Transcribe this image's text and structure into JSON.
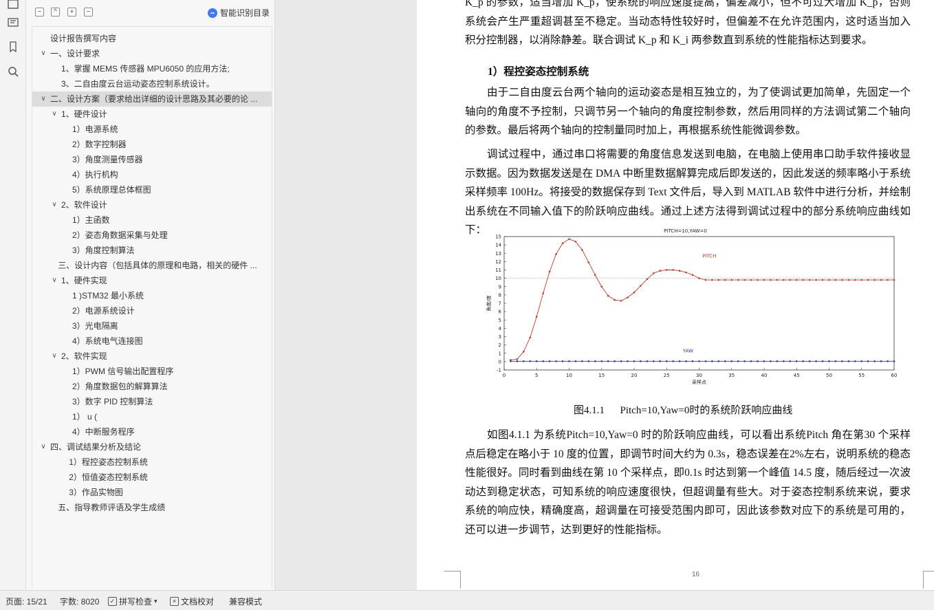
{
  "panel": {
    "toolbar": {
      "collapse_all": "−",
      "expand_all": "^",
      "add_heading": "+",
      "remove_heading": "−",
      "smart_toc": "智能识别目录"
    },
    "outline": [
      {
        "label": "设计报告撰写内容",
        "level": 0,
        "chevron": ""
      },
      {
        "label": "一、设计要求",
        "level": 0,
        "chevron": "v"
      },
      {
        "label": "1、掌握 MEMS 传感器 MPU6050 的应用方法;",
        "level": 1,
        "chevron": ""
      },
      {
        "label": "3、二自由度云台运动姿态控制系统设计。",
        "level": 1,
        "chevron": ""
      },
      {
        "label": "二、设计方案（要求给出详细的设计思路及其必要的论 ...",
        "level": 0,
        "chevron": "v",
        "selected": true
      },
      {
        "label": "1、硬件设计",
        "level": 1,
        "chevron": "v"
      },
      {
        "label": "1）电源系统",
        "level": 2,
        "chevron": ""
      },
      {
        "label": "2）数字控制器",
        "level": 2,
        "chevron": ""
      },
      {
        "label": "3）角度测量传感器",
        "level": 2,
        "chevron": ""
      },
      {
        "label": "4）执行机构",
        "level": 2,
        "chevron": ""
      },
      {
        "label": "5）系统原理总体框图",
        "level": 2,
        "chevron": ""
      },
      {
        "label": "2、软件设计",
        "level": 1,
        "chevron": "v"
      },
      {
        "label": "1）主函数",
        "level": 2,
        "chevron": ""
      },
      {
        "label": "2）姿态角数据采集与处理",
        "level": 2,
        "chevron": ""
      },
      {
        "label": "3）角度控制算法",
        "level": 2,
        "chevron": ""
      },
      {
        "label": "三、设计内容（包括具体的原理和电路，相关的硬件 ...",
        "level": 0.7,
        "chevron": ""
      },
      {
        "label": "1、硬件实现",
        "level": 1,
        "chevron": "v"
      },
      {
        "label": "1 )STM32 最小系统",
        "level": 2,
        "chevron": ""
      },
      {
        "label": "2）电源系统设计",
        "level": 2,
        "chevron": ""
      },
      {
        "label": "3）光电隔离",
        "level": 2,
        "chevron": ""
      },
      {
        "label": "4）系统电气连接图",
        "level": 2,
        "chevron": ""
      },
      {
        "label": "2、软件实现",
        "level": 1,
        "chevron": "v"
      },
      {
        "label": "1）PWM 信号输出配置程序",
        "level": 2,
        "chevron": ""
      },
      {
        "label": "2）角度数据包的解算算法",
        "level": 2,
        "chevron": ""
      },
      {
        "label": "3）数字 PID 控制算法",
        "level": 2,
        "chevron": ""
      },
      {
        "label": "1）        u (",
        "level": 2,
        "chevron": ""
      },
      {
        "label": "4）中断服务程序",
        "level": 2,
        "chevron": ""
      },
      {
        "label": "四、调试结果分析及结论",
        "level": 0,
        "chevron": "v"
      },
      {
        "label": "1）程控姿态控制系统",
        "level": 1.7,
        "chevron": ""
      },
      {
        "label": "2）恒值姿态控制系统",
        "level": 1.7,
        "chevron": ""
      },
      {
        "label": "3）作品实物图",
        "level": 1.7,
        "chevron": ""
      },
      {
        "label": "五、指导教师评语及学生成绩",
        "level": 0.7,
        "chevron": ""
      }
    ]
  },
  "document": {
    "p1": "K_p 的参数，适当增加 K_p，使系统的响应速度提高，偏差减小，但不可过大增加 K_p，否则系统会产生严重超调甚至不稳定。当动态特性较好时，但偏差不在允许范围内，这时适当加入积分控制器，以消除静差。联合调试 K_p 和 K_i 两参数直到系统的性能指标达到要求。",
    "heading1": "1）程控姿态控制系统",
    "p2": "由于二自由度云台两个轴向的运动姿态是相互独立的，为了使调试更加简单，先固定一个轴向的角度不予控制，只调节另一个轴向的角度控制参数，然后用同样的方法调试第二个轴向的参数。最后将两个轴向的控制量同时加上，再根据系统性能微调参数。",
    "p3": "调试过程中，通过串口将需要的角度信息发送到电脑，在电脑上使用串口助手软件接收显示数据。因为数据发送是在 DMA 中断里数据解算完成后即发送的，因此发送的频率略小于系统采样频率 100Hz。将接受的数据保存到 Text 文件后，导入到 MATLAB 软件中进行分析，并绘制出系统在不同输入值下的阶跃响应曲线。通过上述方法得到调试过程中的部分系统响应曲线如下：",
    "caption": "图4.1.1      Pitch=10,Yaw=0时的系统阶跃响应曲线",
    "p4": "如图4.1.1 为系统Pitch=10,Yaw=0 时的阶跃响应曲线，可以看出系统Pitch 角在第30 个采样点后稳定在略小于 10 度的位置，即调节时间大约为 0.3s，稳态误差在2%左右，说明系统的稳态性能很好。同时看到曲线在第 10 个采样点，即0.1s 时达到第一个峰值 14.5 度，随后经过一次波动达到稳定状态，可知系统的响应速度很快，但超调量有些大。对于姿态控制系统来说，要求系统的响应快，精确度高，超调量在可接受范围内即可，因此该参数对应下的系统是可用的，还可以进一步调节，达到更好的性能指标。",
    "page_number": "16"
  },
  "chart_data": {
    "type": "line",
    "title": "PITCH=10,YAW=0",
    "xlabel": "采样点",
    "ylabel": "角度/度",
    "xlim": [
      0,
      60
    ],
    "ylim": [
      -1,
      15
    ],
    "xticks": [
      0,
      5,
      10,
      15,
      20,
      25,
      30,
      35,
      40,
      45,
      50,
      55,
      60
    ],
    "yticks": [
      -1,
      0,
      1,
      2,
      3,
      4,
      5,
      6,
      7,
      8,
      9,
      10,
      11,
      12,
      13,
      14,
      15
    ],
    "reference_line": 10,
    "annotations": [
      "PITCH",
      "YAW"
    ],
    "series": [
      {
        "name": "PITCH",
        "color": "#c0392b",
        "x": [
          1,
          2,
          3,
          4,
          5,
          6,
          7,
          8,
          9,
          10,
          11,
          12,
          13,
          14,
          15,
          16,
          17,
          18,
          19,
          20,
          21,
          22,
          23,
          24,
          25,
          26,
          27,
          28,
          29,
          30,
          31,
          32,
          33,
          34,
          35,
          36,
          37,
          38,
          39,
          40,
          41,
          42,
          43,
          44,
          45,
          46,
          47,
          48,
          49,
          50,
          51,
          52,
          53,
          54,
          55,
          56,
          57,
          58,
          59,
          60
        ],
        "y": [
          0.2,
          0.3,
          1.2,
          2.9,
          5.4,
          8.2,
          10.8,
          12.9,
          14.2,
          14.7,
          14.4,
          13.4,
          11.9,
          10.4,
          9.0,
          7.9,
          7.4,
          7.3,
          7.7,
          8.3,
          9.1,
          9.9,
          10.6,
          10.9,
          11.0,
          11.0,
          10.9,
          10.7,
          10.4,
          10.0,
          9.8,
          9.8,
          9.8,
          9.8,
          9.8,
          9.8,
          9.8,
          9.8,
          9.8,
          9.8,
          9.8,
          9.8,
          9.8,
          9.8,
          9.8,
          9.8,
          9.8,
          9.8,
          9.8,
          9.8,
          9.8,
          9.8,
          9.8,
          9.8,
          9.8,
          9.8,
          9.8,
          9.8,
          9.8,
          9.8
        ]
      },
      {
        "name": "YAW",
        "color": "#2b3a8c",
        "x": [
          1,
          2,
          3,
          4,
          5,
          6,
          7,
          8,
          9,
          10,
          11,
          12,
          13,
          14,
          15,
          16,
          17,
          18,
          19,
          20,
          21,
          22,
          23,
          24,
          25,
          26,
          27,
          28,
          29,
          30,
          31,
          32,
          33,
          34,
          35,
          36,
          37,
          38,
          39,
          40,
          41,
          42,
          43,
          44,
          45,
          46,
          47,
          48,
          49,
          50,
          51,
          52,
          53,
          54,
          55,
          56,
          57,
          58,
          59,
          60
        ],
        "y": [
          0.05,
          0.05,
          0.05,
          0.05,
          0.05,
          0.05,
          0.05,
          0.05,
          0.05,
          0.05,
          0.05,
          0.05,
          0.05,
          0.05,
          0.05,
          0.05,
          0.05,
          0.05,
          0.05,
          0.05,
          0.05,
          0.05,
          0.05,
          0.05,
          0.05,
          0.05,
          0.05,
          0.05,
          0.05,
          0.05,
          0.05,
          0.05,
          0.05,
          0.05,
          0.05,
          0.05,
          0.05,
          0.05,
          0.05,
          0.05,
          0.05,
          0.05,
          0.05,
          0.05,
          0.05,
          0.05,
          0.05,
          0.05,
          0.05,
          0.05,
          0.05,
          0.05,
          0.05,
          0.05,
          0.05,
          0.05,
          0.05,
          0.05,
          0.05,
          0.05
        ]
      }
    ]
  },
  "statusbar": {
    "page": "页面: 15/21",
    "words": "字数: 8020",
    "spellcheck": "拼写检查",
    "proofread": "文档校对",
    "compat": "兼容模式"
  }
}
